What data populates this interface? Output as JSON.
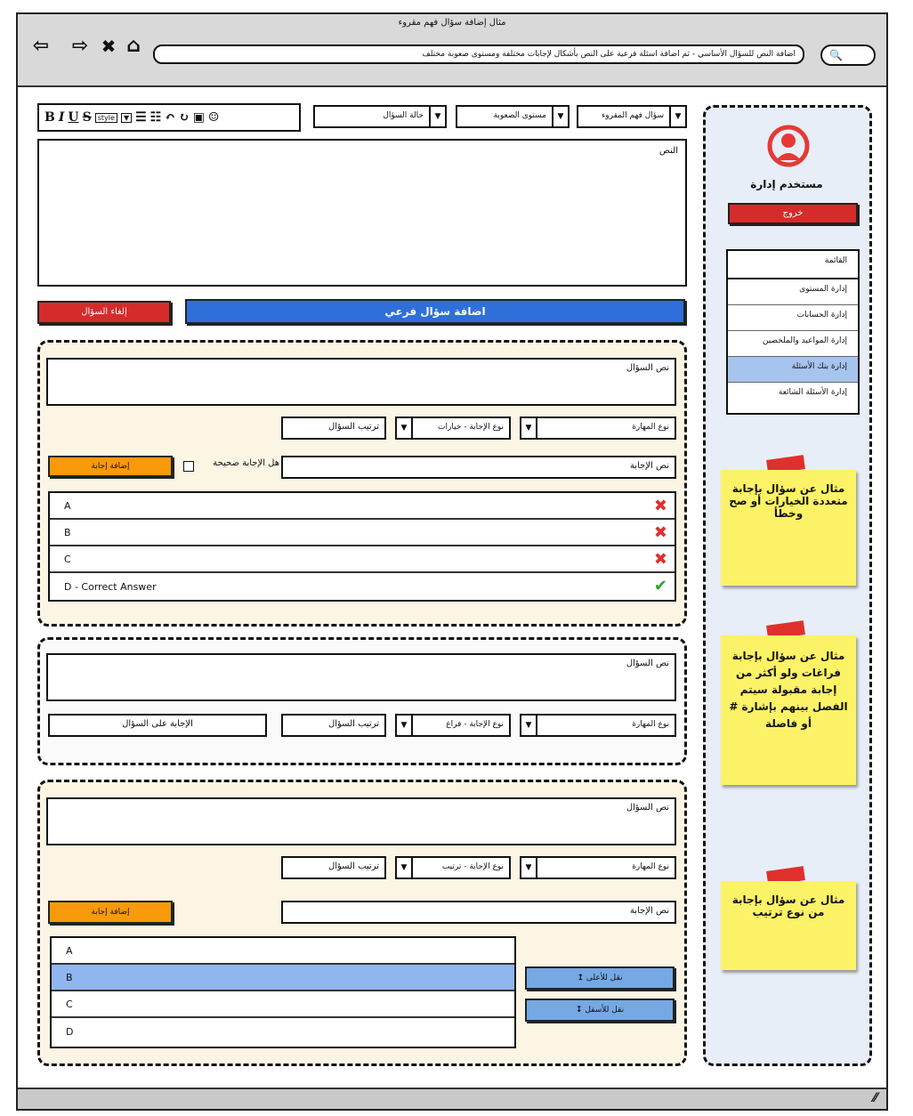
{
  "window": {
    "title": "مثال إضافة سؤال فهم مقروء"
  },
  "nav": {
    "back_icon": "⇦",
    "forward_icon": "⇨",
    "close_icon": "✖",
    "home_icon": "⌂",
    "url": "اضافة النص للسؤال الأساسي - ثم اضافة اسئلة فرعية على النص بأشكال لإجابات مختلفة ومستوى صعوبة مختلف",
    "search_icon": "🔍"
  },
  "editor": {
    "toolbar": {
      "bold": "B",
      "italic": "I",
      "underline": "U",
      "strike": "S",
      "style": "style",
      "arrow": "▼",
      "list1": "☰",
      "list2": "☷",
      "undo": "↶",
      "redo": "↻",
      "image": "▣",
      "emoji": "☺"
    },
    "selects": {
      "question_state": "حالة السؤال",
      "difficulty": "مستوى الصعوبة",
      "question_type": "سؤال فهم المقروء",
      "arrow": "▼"
    },
    "text_label": "النص",
    "cancel_button": "إلغاء السؤال",
    "add_sub_button": "اضافة سؤال فرعي"
  },
  "q1": {
    "question_text_label": "نص السؤال",
    "skill_type": "نوع المهارة",
    "answer_type": "نوع الإجابة - خيارات",
    "order": "ترتيب السؤال",
    "answer_text": "نص الإجابة",
    "is_correct_label": "هل الإجابة صحيحة",
    "add_answer_button": "إضافة إجابة",
    "answers": [
      {
        "label": "A",
        "mark": "✖"
      },
      {
        "label": "B",
        "mark": "✖"
      },
      {
        "label": "C",
        "mark": "✖"
      },
      {
        "label": "D    - Correct Answer",
        "mark": "✔"
      }
    ]
  },
  "q2": {
    "question_text_label": "نص السؤال",
    "skill_type": "نوع المهارة",
    "answer_type": "نوع الإجابة - فراغ",
    "order": "ترتيب السؤال",
    "answer_on_question": "الإجابة على السؤال"
  },
  "q3": {
    "question_text_label": "نص السؤال",
    "skill_type": "نوع المهارة",
    "answer_type": "نوع الإجابة - ترتيب",
    "order": "ترتيب السؤال",
    "answer_text": "نص الإجابة",
    "add_answer_button": "إضافة إجابة",
    "items": [
      "A",
      "B",
      "C",
      "D"
    ],
    "move_up_button": "نقل للأعلى",
    "move_up_icon": "↥",
    "move_down_button": "نقل للأسفل",
    "move_down_icon": "↧"
  },
  "sidebar": {
    "user_name": "مستخدم إدارة",
    "logout_button": "خروج",
    "menu_title": "القائمة",
    "menu_items": [
      "إدارة المستوى",
      "إدارة الحسابات",
      "إدارة المواعيد والملخصين",
      "إدارة بنك الأسئلة",
      "إدارة الأسئلة الشائعة"
    ],
    "active_index": 3
  },
  "notes": [
    "مثال عن سؤال بإجابة متعددة الخيارات أو صح وخطأ",
    "مثال عن سؤال بإجابة فراغات ولو أكثر من إجابة مقبولة سيتم الفصل بينهم بإشارة # أو فاصلة",
    "مثال عن سؤال بإجابة من نوع ترتيب"
  ],
  "colors": {
    "red": "#d62b2b",
    "blue": "#2f6fd9",
    "orange": "#f99a0a",
    "sticky": "#fcf267",
    "sidebar_bg": "#e7eef7"
  },
  "statusbar": {
    "grip": "⁄⁄"
  }
}
